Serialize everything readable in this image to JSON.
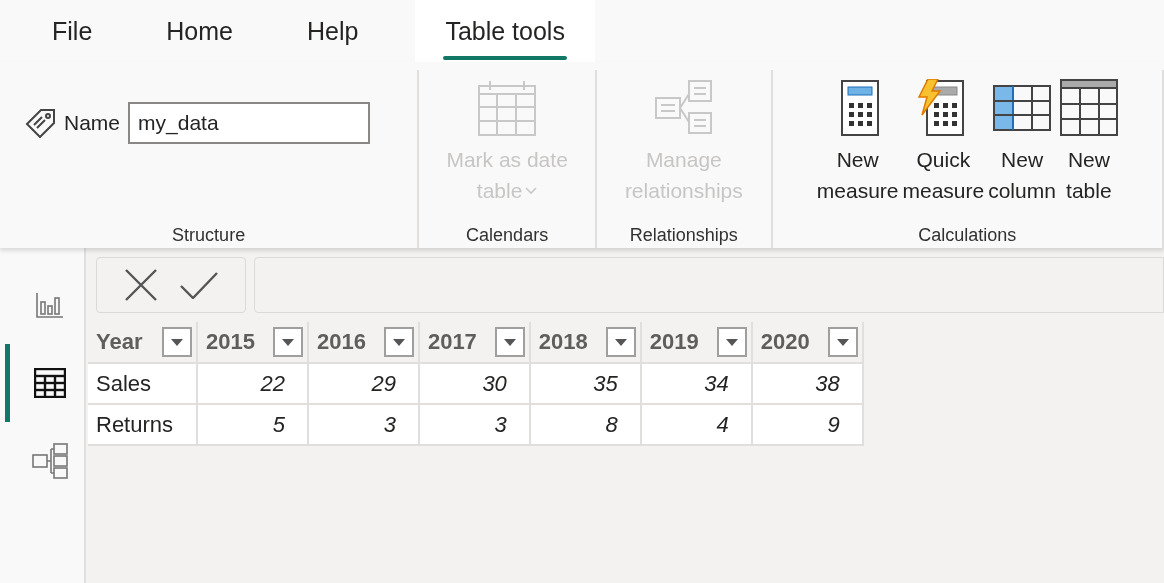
{
  "menu_tabs": [
    {
      "label": "File",
      "selected": false
    },
    {
      "label": "Home",
      "selected": false
    },
    {
      "label": "Help",
      "selected": false
    },
    {
      "label": "Table tools",
      "selected": true
    }
  ],
  "ribbon": {
    "groups": [
      {
        "label": "Structure",
        "items": [
          {
            "kind": "name_field",
            "label": "Name",
            "value": "my_data"
          }
        ]
      },
      {
        "label": "Calendars",
        "items": [
          {
            "kind": "calendar",
            "lines": [
              "Mark as date",
              "table"
            ],
            "dropdown": true,
            "disabled": true
          }
        ]
      },
      {
        "label": "Relationships",
        "items": [
          {
            "kind": "relationships",
            "lines": [
              "Manage",
              "relationships"
            ],
            "dropdown": false,
            "disabled": true
          }
        ]
      },
      {
        "label": "Calculations",
        "items": [
          {
            "kind": "calculator",
            "lines": [
              "New",
              "measure"
            ],
            "dropdown": false,
            "disabled": false
          },
          {
            "kind": "quick_calculator",
            "lines": [
              "Quick",
              "measure"
            ],
            "dropdown": false,
            "disabled": false
          },
          {
            "kind": "column",
            "lines": [
              "New",
              "column"
            ],
            "dropdown": false,
            "disabled": false
          },
          {
            "kind": "table",
            "lines": [
              "New",
              "table"
            ],
            "dropdown": false,
            "disabled": false
          }
        ]
      }
    ]
  },
  "rail": [
    {
      "kind": "report",
      "selected": false
    },
    {
      "kind": "table",
      "selected": true
    },
    {
      "kind": "model",
      "selected": false
    }
  ],
  "table": {
    "columns": [
      "Year",
      "2015",
      "2016",
      "2017",
      "2018",
      "2019",
      "2020"
    ],
    "rows": [
      [
        "Sales",
        "22",
        "29",
        "30",
        "35",
        "34",
        "38"
      ],
      [
        "Returns",
        "5",
        "3",
        "3",
        "8",
        "4",
        "9"
      ]
    ]
  }
}
